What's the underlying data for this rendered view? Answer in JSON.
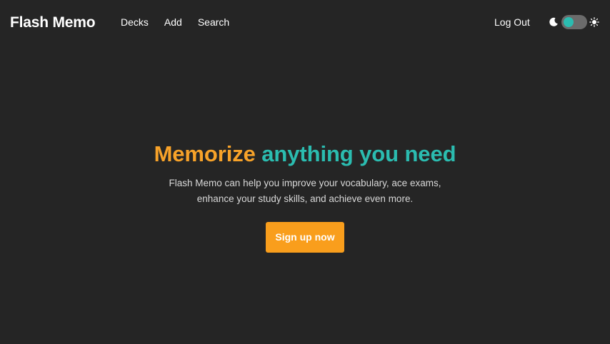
{
  "nav": {
    "brand": "Flash Memo",
    "links": [
      "Decks",
      "Add",
      "Search"
    ],
    "logout_label": "Log Out",
    "theme_toggle": {
      "left_icon": "moon-icon",
      "right_icon": "sun-icon",
      "state": "dark"
    }
  },
  "hero": {
    "title_part1": "Memorize",
    "title_part2": "anything you need",
    "subtitle": "Flash Memo can help you improve your vocabulary, ace exams, enhance your study skills, and achieve even more.",
    "cta_label": "Sign up now"
  },
  "colors": {
    "background": "#252525",
    "accent_orange": "#f7a229",
    "accent_teal": "#2bbcb0",
    "button": "#f99e1c"
  }
}
